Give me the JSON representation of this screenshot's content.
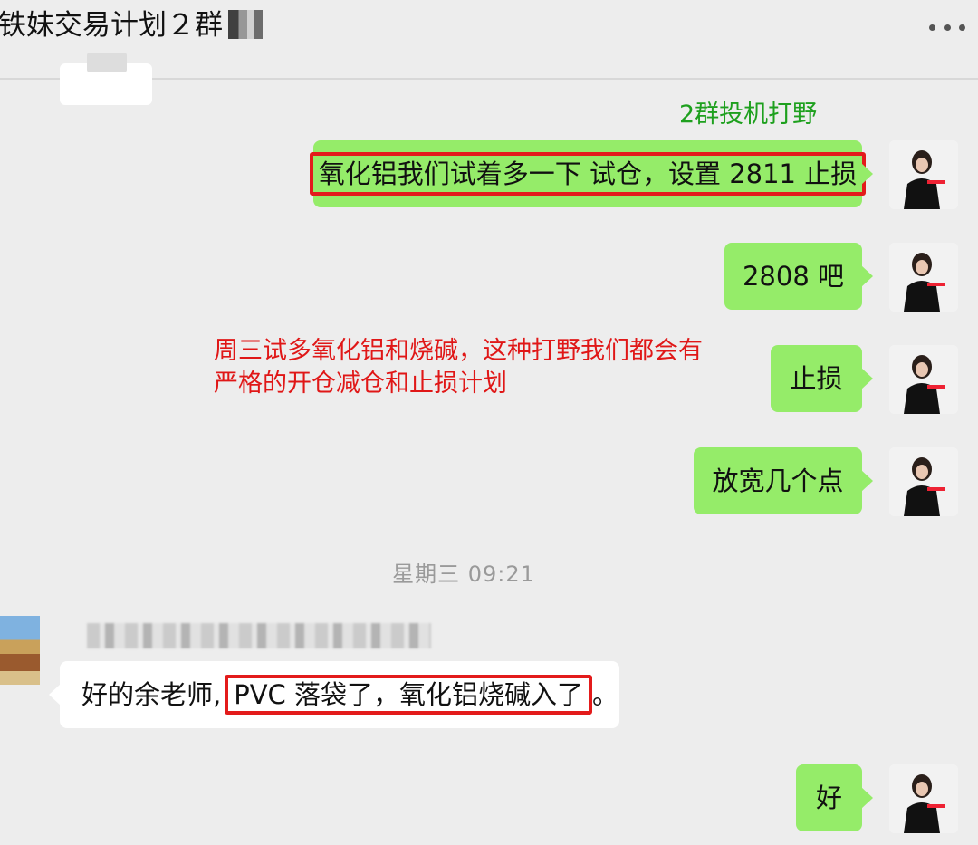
{
  "header": {
    "title": "铁妹交易计划２群",
    "more_icon": "more-horizontal-icon"
  },
  "annotations": {
    "green_note": "2群投机打野",
    "red_note_line1": "周三试多氧化铝和烧碱，这种打野我们都会有",
    "red_note_line2": "严格的开仓减仓和止损计划"
  },
  "messages": [
    {
      "side": "right",
      "text": "氧化铝我们试着多一下 试仓，设置 2811 止损"
    },
    {
      "side": "right",
      "text": "2808 吧"
    },
    {
      "side": "right",
      "text": "止损"
    },
    {
      "side": "right",
      "text": "放宽几个点"
    },
    {
      "side": "left",
      "text_prefix": "好的余老师,",
      "text_highlight": "PVC 落袋了，氧化铝烧碱入了",
      "text_suffix": "。"
    },
    {
      "side": "right",
      "text": "好"
    }
  ],
  "timestamp": "星期三 09:21",
  "colors": {
    "bubble_self": "#95ec69",
    "bubble_other": "#ffffff",
    "highlight_box": "#e31b1b",
    "green_note": "#1ea01e",
    "red_note": "#e01717"
  }
}
